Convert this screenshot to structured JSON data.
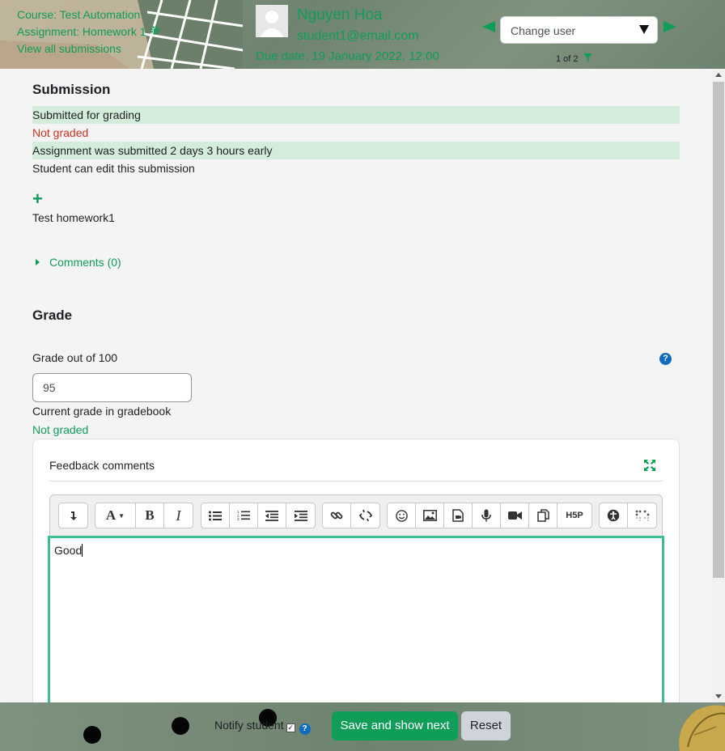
{
  "header": {
    "course_link": "Course: Test Automation",
    "assignment_link": "Assignment: Homework 1",
    "view_all_link": "View all submissions",
    "user_name": "Nguyen Hoa",
    "user_email": "student1@email.com",
    "due_date": "Due date: 19 January 2022, 12:00",
    "change_user_label": "Change user",
    "user_count": "1 of 2",
    "accent_color": "#0f9d58"
  },
  "submission": {
    "title": "Submission",
    "status_submitted": "Submitted for grading",
    "status_grading": "Not graded",
    "time_remaining": "Assignment was submitted 2 days 3 hours early",
    "edit_status": "Student can edit this submission",
    "online_text": "Test homework1",
    "comments_link": "Comments (0)"
  },
  "grade": {
    "title": "Grade",
    "grade_label": "Grade out of 100",
    "grade_value": "95",
    "gradebook_label": "Current grade in gradebook",
    "gradebook_value": "Not graded"
  },
  "feedback": {
    "title": "Feedback comments",
    "editor_text": "Good",
    "toolbar_icons": [
      "collapse-icon",
      "font-style-icon",
      "bold-icon",
      "italic-icon",
      "unordered-list-icon",
      "ordered-list-icon",
      "outdent-icon",
      "indent-icon",
      "link-icon",
      "unlink-icon",
      "emoji-icon",
      "image-icon",
      "media-icon",
      "record-audio-icon",
      "record-video-icon",
      "manage-files-icon",
      "h5p-icon",
      "accessibility-checker-icon",
      "screenreader-helper-icon"
    ],
    "bold_glyph": "B",
    "italic_glyph": "I",
    "font_glyph": "A",
    "h5p_glyph": "H5P"
  },
  "footer": {
    "notify_label": "Notify student",
    "save_button": "Save and show next",
    "reset_button": "Reset"
  }
}
